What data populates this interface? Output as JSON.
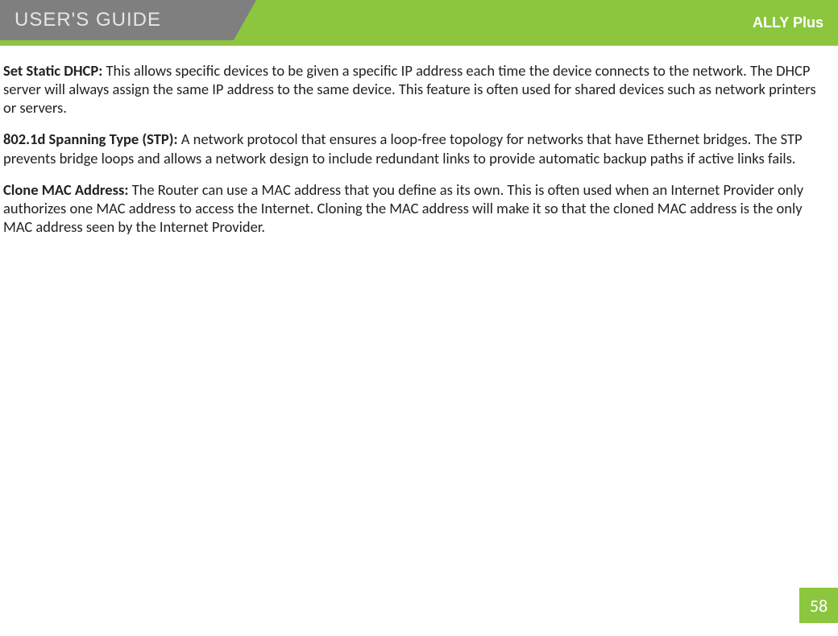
{
  "header": {
    "title": "USER'S GUIDE",
    "brand": "ALLY Plus"
  },
  "sections": [
    {
      "label": "Set Static DHCP:",
      "text": " This allows specific devices to be given a specific IP address each time the device connects to the network. The DHCP server will always assign the same IP address to the same device. This feature is often used for shared devices such as network printers or servers."
    },
    {
      "label": "802.1d Spanning Type (STP):",
      "text": " A network protocol that ensures a loop-free topology for networks that have Ethernet bridges. The STP prevents bridge loops and allows a network design to include redundant links to provide automatic backup paths if active links fails."
    },
    {
      "label": "Clone MAC Address:",
      "text": " The Router can use a MAC address that you define as its own. This is often used when an Internet Provider only authorizes one MAC address to access the Internet. Cloning the MAC address will make it so that the cloned MAC address is the only MAC address seen by the Internet Provider."
    }
  ],
  "page_number": "58"
}
